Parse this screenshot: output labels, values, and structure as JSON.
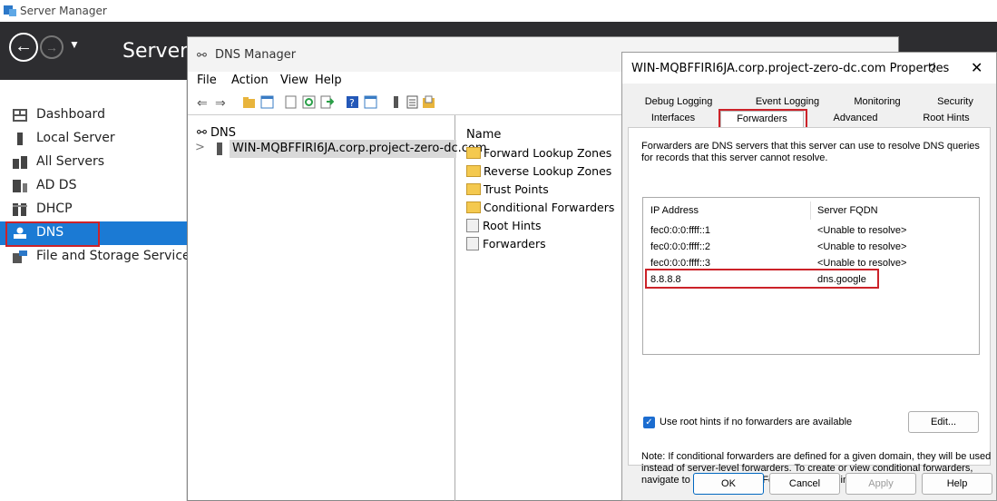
{
  "server_manager": {
    "window_title": "Server Manager",
    "header_title": "Server",
    "nav": [
      {
        "label": "Dashboard",
        "icon": "dashboard-icon"
      },
      {
        "label": "Local Server",
        "icon": "server-icon"
      },
      {
        "label": "All Servers",
        "icon": "servers-icon"
      },
      {
        "label": "AD DS",
        "icon": "adds-icon"
      },
      {
        "label": "DHCP",
        "icon": "dhcp-icon"
      },
      {
        "label": "DNS",
        "icon": "dns-icon",
        "selected": true
      },
      {
        "label": "File and Storage Services",
        "icon": "storage-icon"
      }
    ]
  },
  "dns_manager": {
    "title": "DNS Manager",
    "menu": [
      "File",
      "Action",
      "View",
      "Help"
    ],
    "tree": {
      "root": "DNS",
      "server_node": "WIN-MQBFFIRI6JA.corp.project-zero-dc.com"
    },
    "list": {
      "header": "Name",
      "items": [
        {
          "label": "Forward Lookup Zones",
          "icon": "folder-icon"
        },
        {
          "label": "Reverse Lookup Zones",
          "icon": "folder-icon"
        },
        {
          "label": "Trust Points",
          "icon": "folder-icon"
        },
        {
          "label": "Conditional Forwarders",
          "icon": "folder-icon"
        },
        {
          "label": "Root Hints",
          "icon": "document-icon"
        },
        {
          "label": "Forwarders",
          "icon": "document-icon"
        }
      ]
    }
  },
  "properties_dialog": {
    "title": "WIN-MQBFFIRI6JA.corp.project-zero-dc.com Properties",
    "help_glyph": "?",
    "close_glyph": "✕",
    "tabs_row1": [
      "Debug Logging",
      "Event Logging",
      "Monitoring",
      "Security"
    ],
    "tabs_row2": [
      "Interfaces",
      "Forwarders",
      "Advanced",
      "Root Hints"
    ],
    "active_tab": "Forwarders",
    "description": "Forwarders are DNS servers that this server can use to resolve DNS queries for records that this server cannot resolve.",
    "columns": [
      "IP Address",
      "Server FQDN"
    ],
    "rows": [
      {
        "ip": "fec0:0:0:ffff::1",
        "fqdn": "<Unable to resolve>"
      },
      {
        "ip": "fec0:0:0:ffff::2",
        "fqdn": "<Unable to resolve>"
      },
      {
        "ip": "fec0:0:0:ffff::3",
        "fqdn": "<Unable to resolve>"
      },
      {
        "ip": "8.8.8.8",
        "fqdn": "dns.google"
      }
    ],
    "use_root_hints_label": "Use root hints if no forwarders are available",
    "use_root_hints_checked": true,
    "edit_button": "Edit...",
    "note": "Note: If conditional forwarders are defined for a given domain, they will be used instead of server-level forwarders.  To create or view conditional forwarders, navigate to the Conditional Forwarders node in the scope tree.",
    "buttons": {
      "ok": "OK",
      "cancel": "Cancel",
      "apply": "Apply",
      "help": "Help"
    }
  },
  "colors": {
    "header_bg": "#2d2d30",
    "nav_selected": "#1b7ad4",
    "highlight_box": "#cc2229",
    "checkbox": "#1c6dd0"
  }
}
